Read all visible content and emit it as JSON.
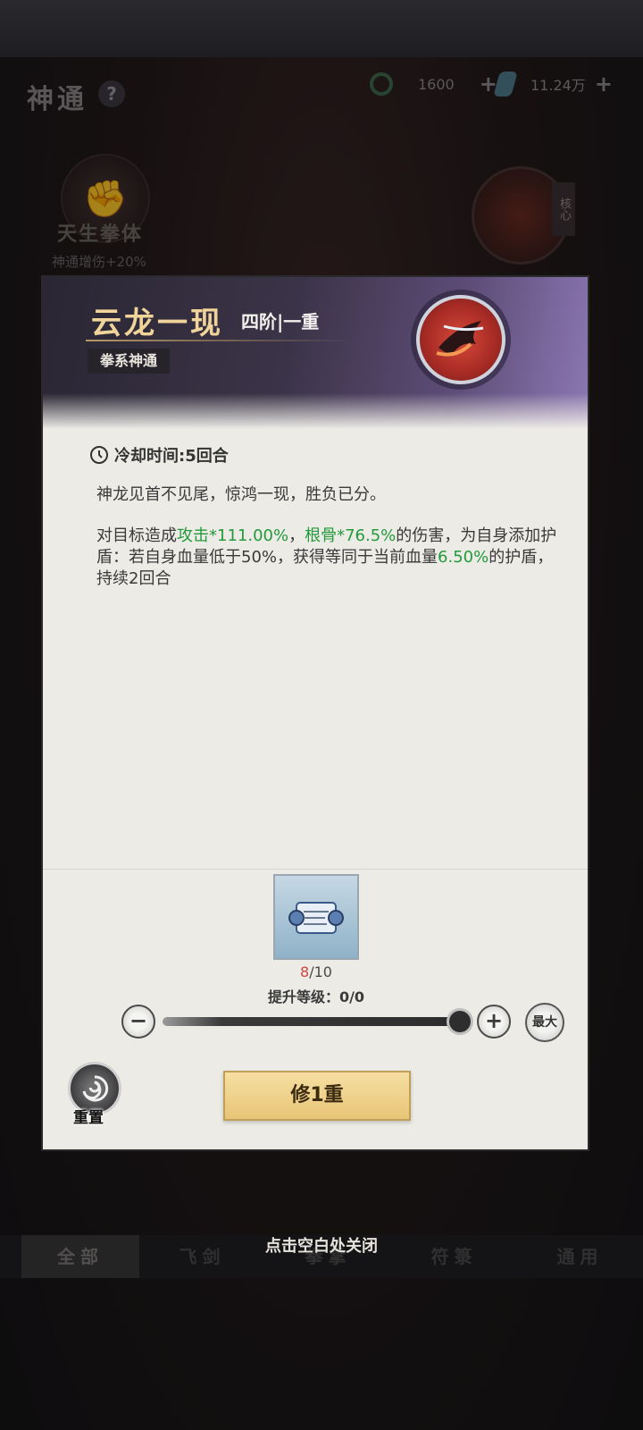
{
  "page": {
    "title": "神通",
    "help_icon": "?",
    "resources": [
      {
        "icon": "jade-ring-icon",
        "value": "1600",
        "plus": "+"
      },
      {
        "icon": "crystal-icon",
        "value": "11.24万",
        "plus": "+"
      }
    ],
    "left_skill": {
      "name": "天生拳体",
      "bonus": "神通增伤+20%"
    },
    "core_tag": "核心",
    "tabs": [
      "全部",
      "飞剑",
      "拳掌",
      "符箓",
      "通用"
    ],
    "active_tab": "全部",
    "close_hint": "点击空白处关闭"
  },
  "dialog": {
    "skill_name": "云龙一现",
    "skill_rank": "四阶|一重",
    "skill_type": "拳系神通",
    "cooldown": "冷却时间:5回合",
    "flavor": "神龙见首不见尾，惊鸿一现，胜负已分。",
    "effect": {
      "p1": "对目标造成",
      "attack": "攻击*111.00%",
      "sep1": "，",
      "bone": "根骨*76.5%",
      "p2": "的伤害，为自身添加护盾：若自身血量低于50%，获得等同于当前血量",
      "shield": "6.50%",
      "p3": "的护盾，持续2回合"
    },
    "item": {
      "icon": "scroll-icon",
      "count_current": "8",
      "count_sep": "/",
      "count_total": "10"
    },
    "upgrade_level": "提升等级：0/0",
    "minus_label": "−",
    "plus_label": "+",
    "max_label": "最大",
    "reset_label": "重置",
    "primary_button": "修1重",
    "colors": {
      "accent_gold": "#f0d49a",
      "highlight_green": "#239a3b",
      "count_red": "#d0473c",
      "button_gold": "#e8c577"
    }
  }
}
